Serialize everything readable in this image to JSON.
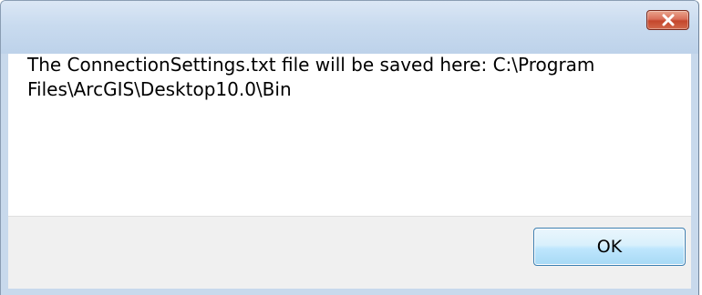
{
  "dialog": {
    "close_icon": "close-icon",
    "message": "The ConnectionSettings.txt file will be saved here: C:\\Program Files\\ArcGIS\\Desktop10.0\\Bin",
    "ok_label": "OK"
  },
  "colors": {
    "frame": "#c8d9ec",
    "close_button": "#c4462c",
    "footer": "#f0f0f0",
    "ok_button_border": "#3c7fb1"
  }
}
